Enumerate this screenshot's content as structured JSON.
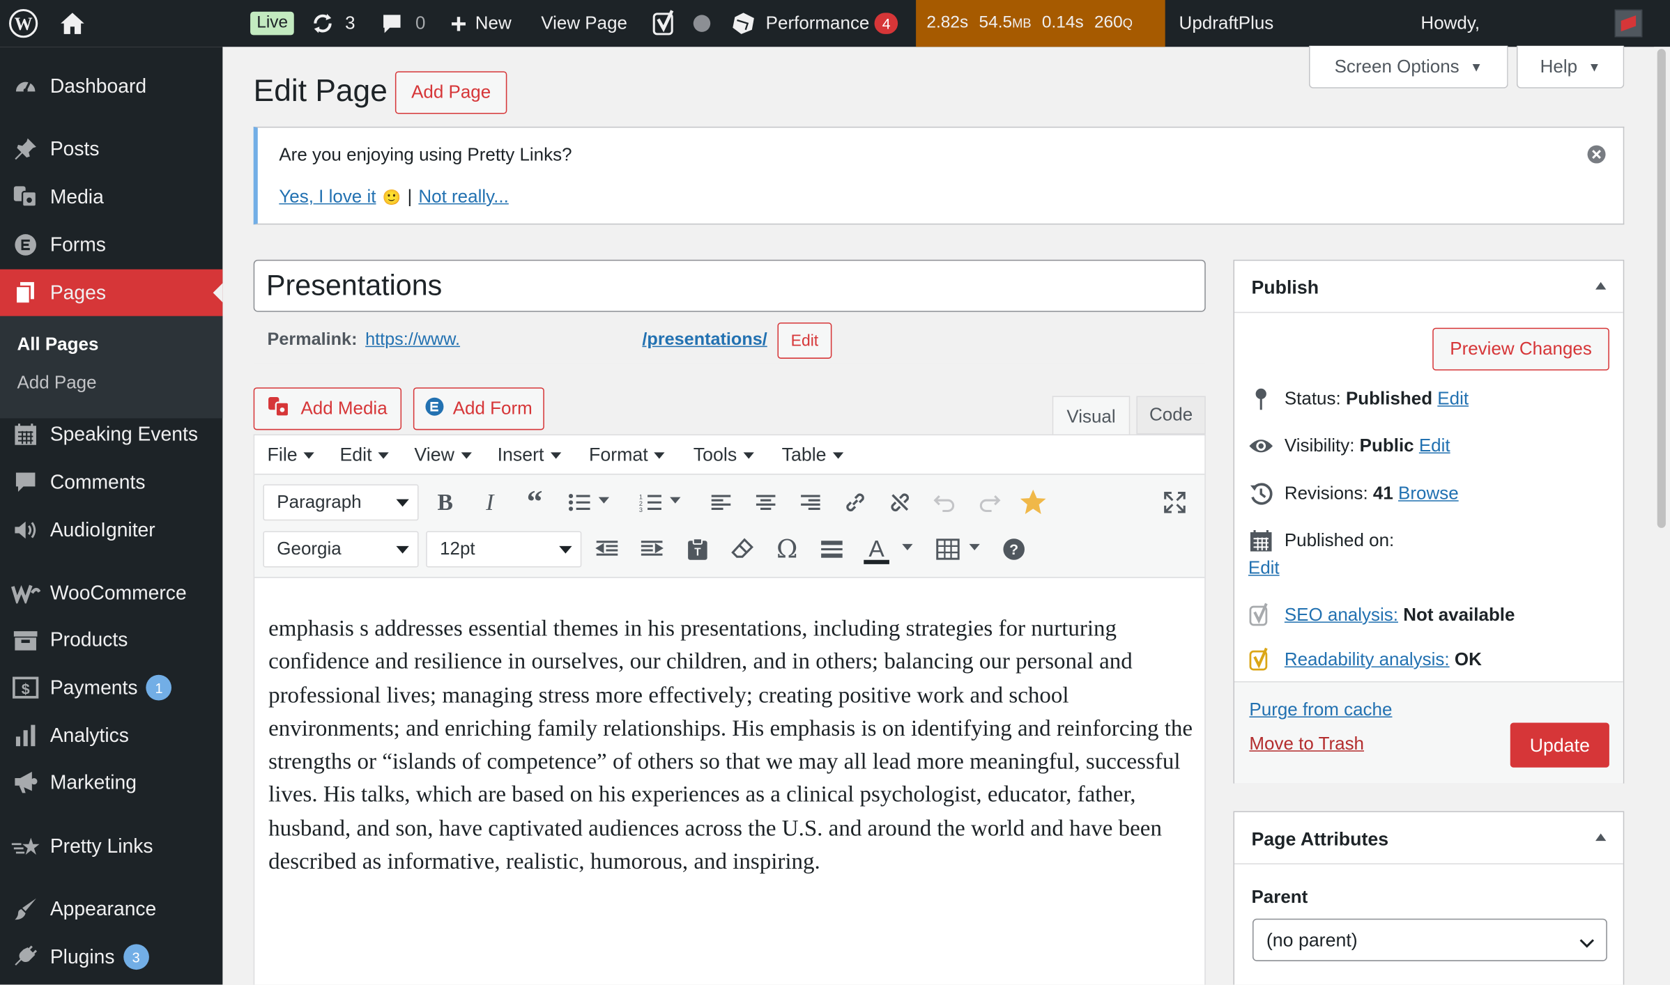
{
  "admin_bar": {
    "live": "Live",
    "updates": "3",
    "comments": "0",
    "new": "New",
    "view_page": "View Page",
    "performance": "Performance",
    "performance_count": "4",
    "qm_time": "2.82s",
    "qm_memory": "54.5",
    "qm_memory_unit": "MB",
    "qm_db_time": "0.14s",
    "qm_queries": "260",
    "qm_queries_unit": "Q",
    "updraft": "UpdraftPlus",
    "howdy": "Howdy,"
  },
  "sidebar": {
    "items": [
      {
        "label": "Dashboard",
        "icon": "dashboard-icon"
      },
      {
        "label": "Posts",
        "icon": "pushpin-icon"
      },
      {
        "label": "Media",
        "icon": "media-icon"
      },
      {
        "label": "Forms",
        "icon": "forms-icon"
      },
      {
        "label": "Pages",
        "icon": "pages-icon"
      },
      {
        "label": "Speaking Events",
        "icon": "calendar-icon"
      },
      {
        "label": "Comments",
        "icon": "comment-icon"
      },
      {
        "label": "AudioIgniter",
        "icon": "audio-icon"
      },
      {
        "label": "WooCommerce",
        "icon": "woocommerce-icon"
      },
      {
        "label": "Products",
        "icon": "products-icon"
      },
      {
        "label": "Payments",
        "icon": "payments-icon",
        "badge": "1"
      },
      {
        "label": "Analytics",
        "icon": "analytics-icon"
      },
      {
        "label": "Marketing",
        "icon": "megaphone-icon"
      },
      {
        "label": "Pretty Links",
        "icon": "star-link-icon"
      },
      {
        "label": "Appearance",
        "icon": "brush-icon"
      },
      {
        "label": "Plugins",
        "icon": "plugin-icon",
        "badge": "3"
      }
    ],
    "pages_sub": {
      "all_pages": "All Pages",
      "add_page": "Add Page"
    }
  },
  "header": {
    "title": "Edit Page",
    "add_page": "Add Page",
    "screen_options": "Screen Options",
    "help": "Help"
  },
  "notice": {
    "question": "Are you enjoying using Pretty Links?",
    "yes": "Yes, I love it",
    "emoji": "🙂",
    "sep": "|",
    "no": "Not really..."
  },
  "editor": {
    "title_value": "Presentations",
    "permalink_label": "Permalink:",
    "permalink_start": "https://www.",
    "permalink_end": "/presentations/",
    "permalink_edit": "Edit",
    "add_media": "Add Media",
    "add_form": "Add Form",
    "tab_visual": "Visual",
    "tab_code": "Code",
    "menus": [
      "File",
      "Edit",
      "View",
      "Insert",
      "Format",
      "Tools",
      "Table"
    ],
    "format_select": "Paragraph",
    "font_select": "Georgia",
    "size_select": "12pt",
    "content": "emphasis s addresses essential themes in his presentations, including strategies for nurturing confidence and resilience in ourselves, our children, and in others; balancing our personal and professional lives; managing stress more effectively; creating positive work and school environments; and enriching family relationships.  His emphasis is on identifying and reinforcing the strengths or “islands of competence” of others so that we may all lead more meaningful, successful lives.  His talks, which are based on his experiences as a clinical psychologist, educator, father, husband, and son, have captivated audiences across the U.S. and around the world and have been described as informative, realistic, humorous, and inspiring."
  },
  "publish": {
    "title": "Publish",
    "preview": "Preview Changes",
    "status_label": "Status:",
    "status_value": "Published",
    "status_edit": "Edit",
    "visibility_label": "Visibility:",
    "visibility_value": "Public",
    "visibility_edit": "Edit",
    "revisions_label": "Revisions:",
    "revisions_value": "41",
    "revisions_browse": "Browse",
    "published_on": "Published on:",
    "published_edit": "Edit",
    "seo_label": "SEO analysis:",
    "seo_value": "Not available",
    "readability_label": "Readability analysis:",
    "readability_value": "OK",
    "purge": "Purge from cache",
    "trash": "Move to Trash",
    "update": "Update"
  },
  "attributes": {
    "title": "Page Attributes",
    "parent_label": "Parent",
    "parent_value": "(no parent)"
  },
  "colors": {
    "accent": "#d63638",
    "admin_bar": "#1d2327",
    "link": "#2271b1",
    "qm": "#a65a00"
  }
}
